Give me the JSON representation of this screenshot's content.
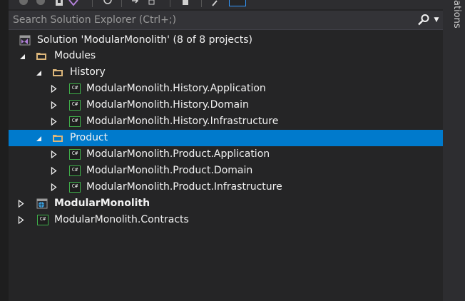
{
  "side_tab": {
    "label": "ations"
  },
  "search": {
    "placeholder": "Search Solution Explorer (Ctrl+;)",
    "value": ""
  },
  "tree": {
    "solution": "Solution 'ModularMonolith' (8 of 8 projects)",
    "modules": "Modules",
    "history": "History",
    "history_app": "ModularMonolith.History.Application",
    "history_domain": "ModularMonolith.History.Domain",
    "history_infra": "ModularMonolith.History.Infrastructure",
    "product": "Product",
    "product_app": "ModularMonolith.Product.Application",
    "product_domain": "ModularMonolith.Product.Domain",
    "product_infra": "ModularMonolith.Product.Infrastructure",
    "web": "ModularMonolith",
    "contracts": "ModularMonolith.Contracts"
  },
  "icons": {
    "csharp_badge": "C#",
    "solution_icon": "visual-studio-solution",
    "folder_icon": "folder-open",
    "web_icon": "web-project"
  },
  "colors": {
    "selection": "#007acc",
    "background": "#252526",
    "csharp_green": "#3fb04a",
    "folder": "#dcb67a"
  }
}
